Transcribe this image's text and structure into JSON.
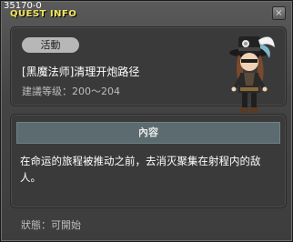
{
  "header": {
    "quest_id": "35170-0",
    "title": "QUEST INFO",
    "close_label": "×"
  },
  "quest": {
    "type_badge": "活動",
    "title": "[黑魔法师]清理开炮路径",
    "level_req": "建議等级：200～204"
  },
  "details": {
    "section_label": "內容",
    "description": "在命运的旅程被推动之前，去消灭聚集在射程内的敌人。"
  },
  "status": {
    "text": "狀態：可開始"
  },
  "colors": {
    "title_yellow": "#f2e85a",
    "header_teal": "#5b6b70"
  }
}
